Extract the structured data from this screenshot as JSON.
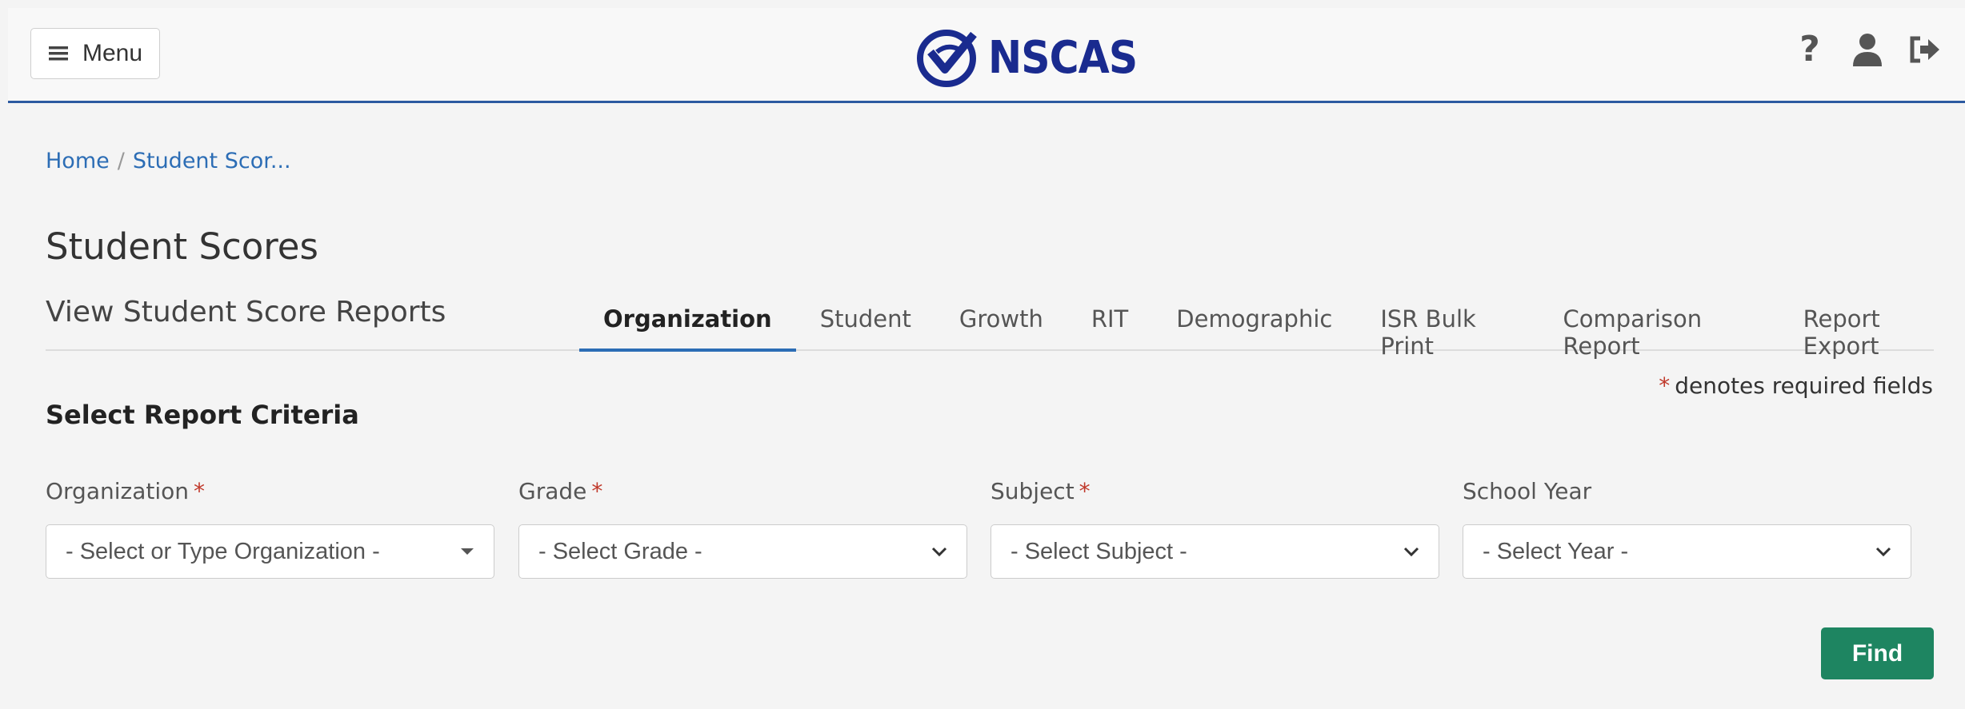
{
  "header": {
    "menu_label": "Menu",
    "logo_text": "NSCAS",
    "icons": [
      "help-icon",
      "user-icon",
      "logout-icon"
    ]
  },
  "breadcrumb": {
    "home": "Home",
    "current": "Student Scor..."
  },
  "page": {
    "title": "Student Scores",
    "subtitle": "View Student Score Reports"
  },
  "tabs": [
    {
      "label": "Organization",
      "active": true
    },
    {
      "label": "Student"
    },
    {
      "label": "Growth"
    },
    {
      "label": "RIT"
    },
    {
      "label": "Demographic"
    },
    {
      "label": "ISR Bulk Print"
    },
    {
      "label": "Comparison Report"
    },
    {
      "label": "Report Export"
    }
  ],
  "required_note": {
    "star": "*",
    "text": "denotes required fields"
  },
  "criteria": {
    "title": "Select Report Criteria",
    "fields": [
      {
        "label": "Organization",
        "required": "*",
        "value": "- Select or Type Organization -"
      },
      {
        "label": "Grade",
        "required": "*",
        "value": "- Select Grade -"
      },
      {
        "label": "Subject",
        "required": "*",
        "value": "- Select Subject -"
      },
      {
        "label": "School Year",
        "required": "",
        "value": "- Select Year -"
      }
    ]
  },
  "actions": {
    "find_label": "Find"
  },
  "colors": {
    "brand": "#1a2b8f",
    "link": "#2c6db5",
    "primary_button": "#1e8561",
    "required": "#c0392b"
  }
}
